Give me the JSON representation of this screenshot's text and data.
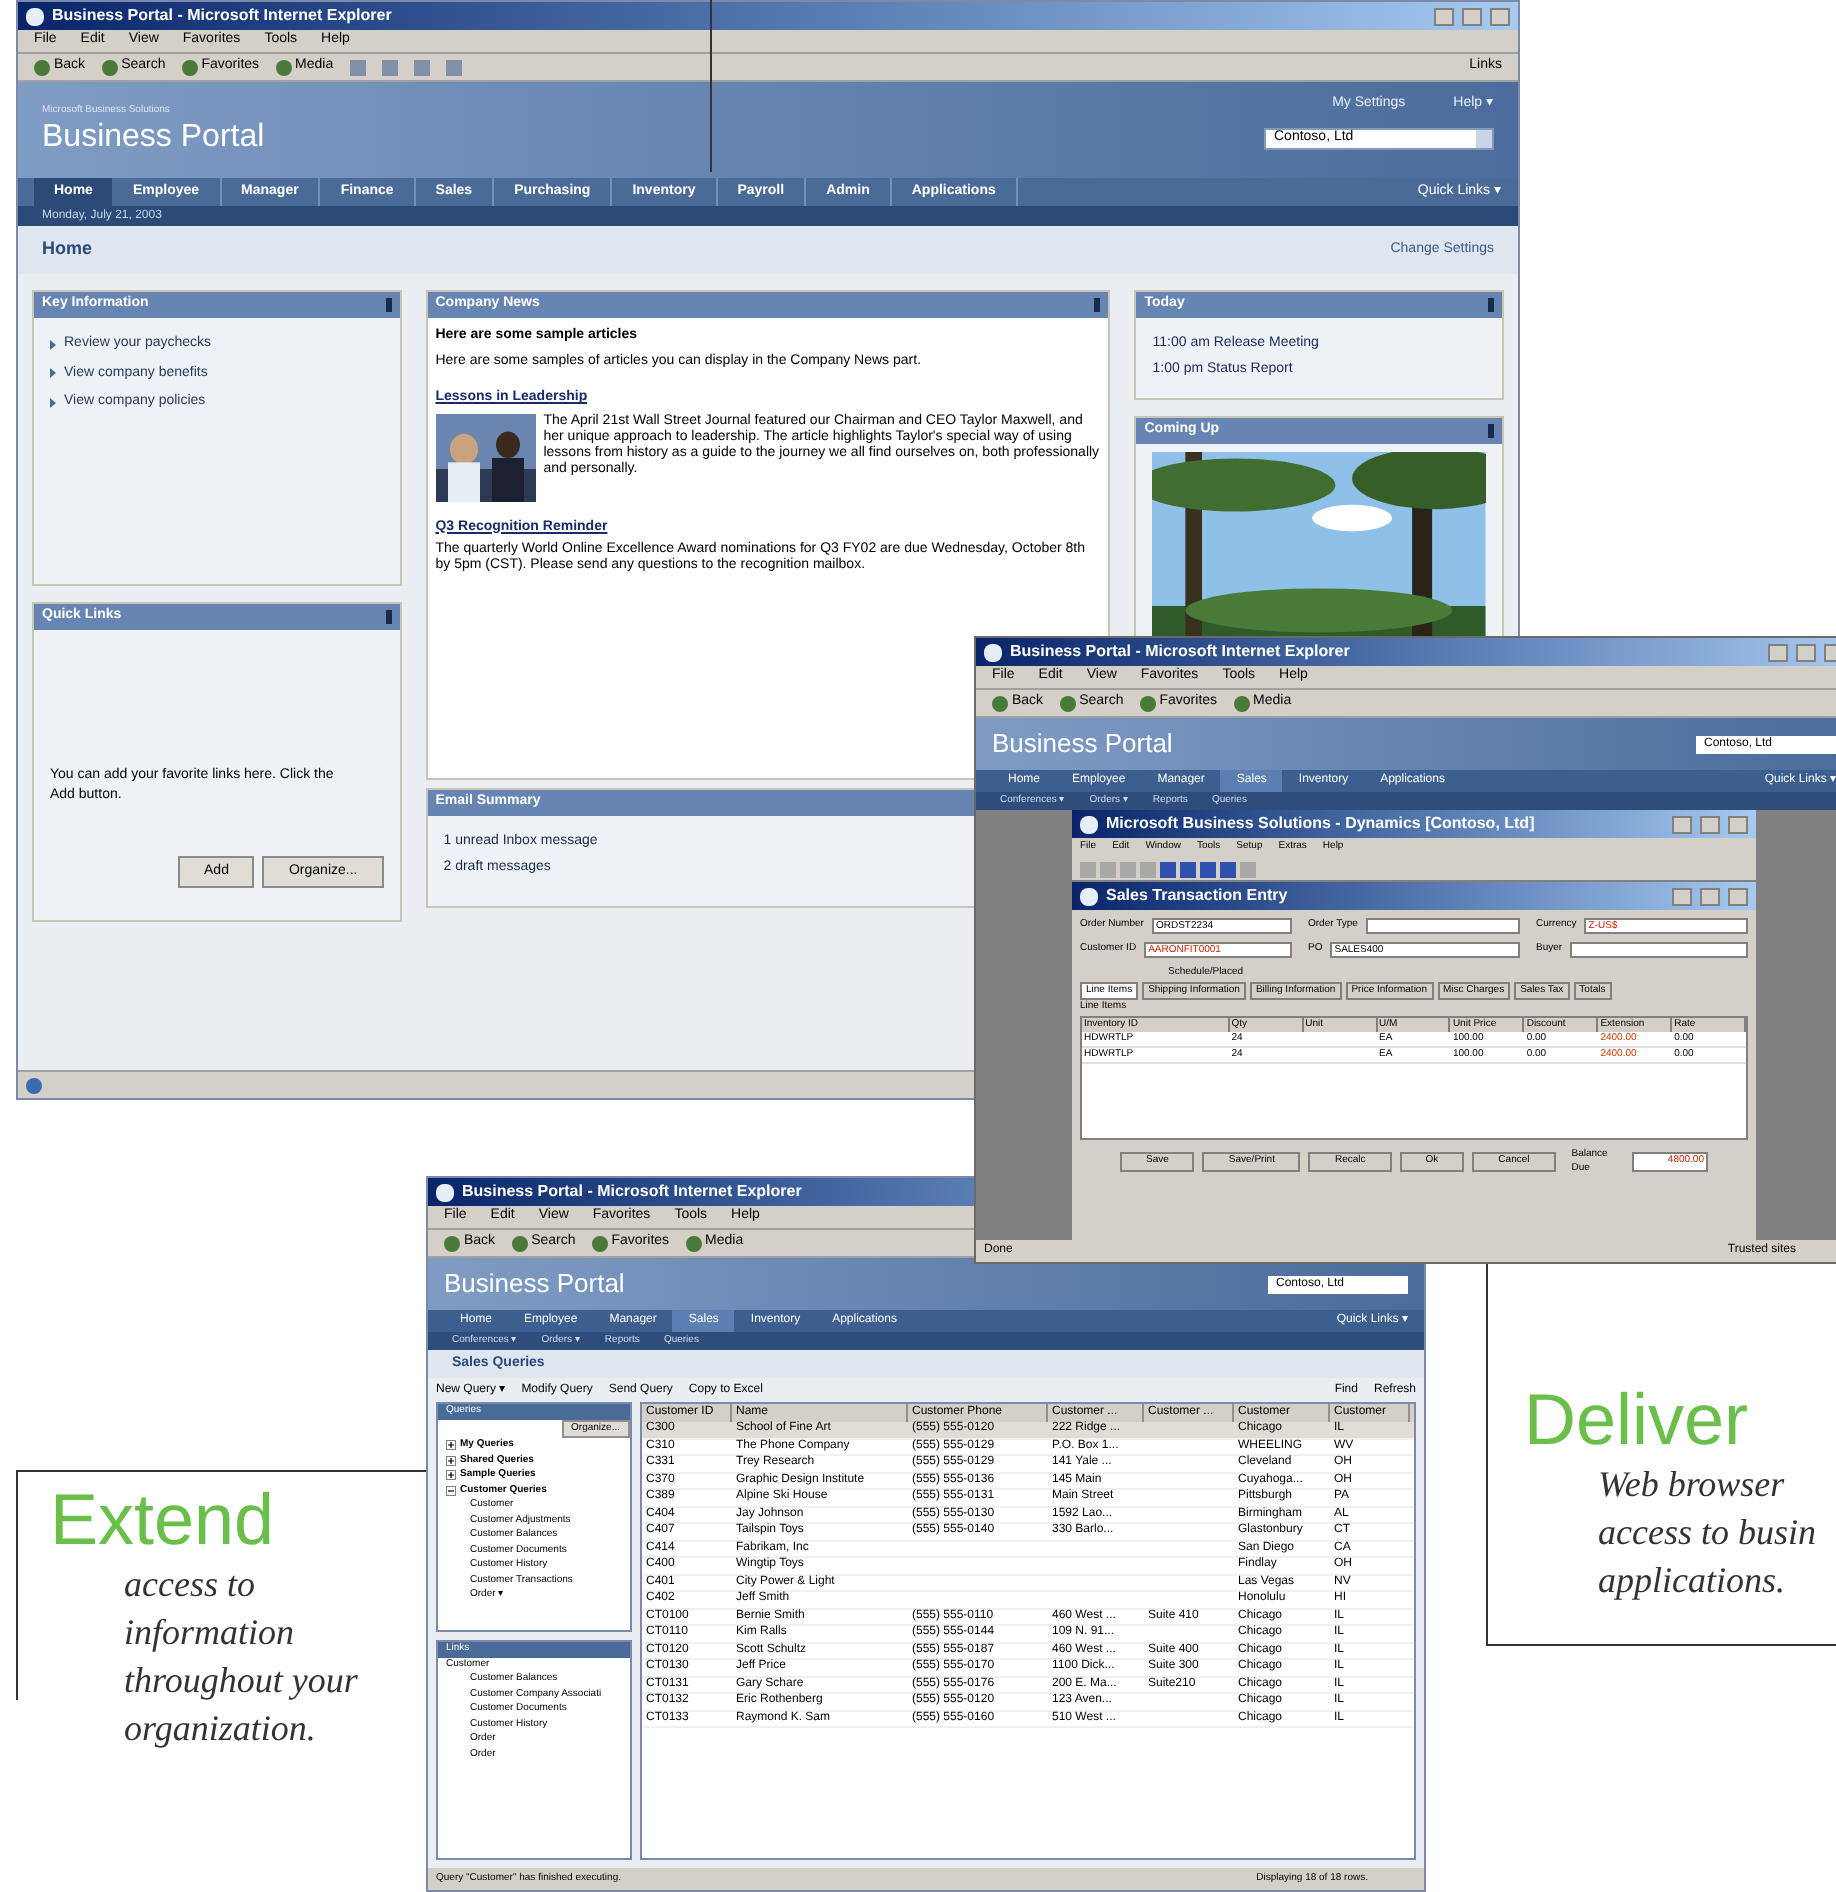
{
  "main_window": {
    "title": "Business Portal - Microsoft Internet Explorer",
    "menu": [
      "File",
      "Edit",
      "View",
      "Favorites",
      "Tools",
      "Help"
    ],
    "toolbar": [
      "Back",
      "Search",
      "Favorites",
      "Media"
    ],
    "links_label": "Links",
    "portal": {
      "brand_small": "Microsoft Business Solutions",
      "brand": "Business Portal",
      "header_links": [
        "My Settings",
        "Help ▾"
      ],
      "company": "Contoso, Ltd",
      "tabs": [
        {
          "label": "Home",
          "selected": true
        },
        {
          "label": "Employee",
          "selected": false
        },
        {
          "label": "Manager",
          "selected": false
        },
        {
          "label": "Finance",
          "selected": false
        },
        {
          "label": "Sales",
          "selected": false
        },
        {
          "label": "Purchasing",
          "selected": false
        },
        {
          "label": "Inventory",
          "selected": false
        },
        {
          "label": "Payroll",
          "selected": false
        },
        {
          "label": "Admin",
          "selected": false
        },
        {
          "label": "Applications",
          "selected": false
        }
      ],
      "quick_links": "Quick Links ▾",
      "date": "Monday, July 21, 2003",
      "page_title": "Home",
      "change_settings": "Change Settings",
      "key_info": {
        "title": "Key Information",
        "links": [
          "Review your paychecks",
          "View company benefits",
          "View company policies"
        ]
      },
      "quick": {
        "title": "Quick Links",
        "text": "You can add your favorite links here. Click the Add button.",
        "buttons": [
          "Add",
          "Organize..."
        ]
      },
      "news": {
        "title": "Company News",
        "heading": "Here are some sample articles",
        "intro": "Here are some samples of articles you can display in the Company News part.",
        "articles": [
          {
            "title": "Lessons in Leadership",
            "picture": true,
            "text": "The April 21st Wall Street Journal featured our Chairman and CEO Taylor Maxwell, and her unique approach to leadership. The article highlights Taylor's special way of using lessons from history as a guide to the journey we all find ourselves on, both professionally and personally."
          },
          {
            "title": "Q3 Recognition Reminder",
            "picture": false,
            "text": "The quarterly World Online Excellence Award nominations for Q3 FY02 are due Wednesday, October 8th by 5pm (CST). Please send any questions to the recognition mailbox."
          }
        ]
      },
      "email": {
        "title": "Email Summary",
        "lines": [
          "1 unread Inbox message",
          "2 draft messages"
        ]
      },
      "today": {
        "title": "Today",
        "events": [
          {
            "time": "11:00 am",
            "text": "Release Meeting"
          },
          {
            "time": "1:00 pm",
            "text": "Status Report"
          }
        ]
      },
      "coming_up": {
        "title": "Coming Up"
      }
    }
  },
  "order_window": {
    "title": "Business Portal - Microsoft Internet Explorer",
    "menu": [
      "File",
      "Edit",
      "View",
      "Favorites",
      "Tools",
      "Help"
    ],
    "toolbar": [
      "Back",
      "Search",
      "Favorites",
      "Media"
    ],
    "portal": {
      "brand": "Business Portal",
      "company": "Contoso, Ltd",
      "tabs": [
        {
          "label": "Home",
          "selected": false
        },
        {
          "label": "Employee",
          "selected": false
        },
        {
          "label": "Manager",
          "selected": false
        },
        {
          "label": "Sales",
          "selected": true
        },
        {
          "label": "Inventory",
          "selected": false
        },
        {
          "label": "Applications",
          "selected": false
        }
      ],
      "quick_links": "Quick Links ▾",
      "subnav": [
        "Conferences ▾",
        "Orders ▾",
        "Reports",
        "Queries"
      ]
    },
    "app": {
      "title": "Microsoft Business Solutions - Dynamics [Contoso, Ltd]",
      "menu": [
        "File",
        "Edit",
        "Window",
        "Tools",
        "Setup",
        "Extras",
        "Help"
      ],
      "form": {
        "title": "Sales Transaction Entry",
        "fields": [
          {
            "label": "Order Number",
            "value": "ORDST2234",
            "alert": false
          },
          {
            "label": "Order Type",
            "alert": false
          },
          {
            "label": "Currency",
            "value": "Z-US$",
            "alert": true
          },
          {
            "label": "Customer ID",
            "value": "AARONFIT0001",
            "alert": true
          },
          {
            "label": "PO",
            "value": "SALES400",
            "alert": false
          },
          {
            "label": "Buyer",
            "alert": false
          }
        ],
        "sub_label": "Schedule/Placed",
        "tabs": [
          {
            "label": "Line Items",
            "selected": true
          },
          {
            "label": "Shipping Information",
            "selected": false
          },
          {
            "label": "Billing Information",
            "selected": false
          },
          {
            "label": "Price Information",
            "selected": false
          },
          {
            "label": "Misc Charges",
            "selected": false
          },
          {
            "label": "Sales Tax",
            "selected": false
          },
          {
            "label": "Totals",
            "selected": false
          }
        ],
        "grid_title": "Line Items",
        "columns": [
          "Inventory ID",
          "Qty",
          "Unit",
          "U/M",
          "Unit Price",
          "Discount",
          "Extension",
          "Rate"
        ],
        "rows": [
          [
            "HDWRTLP",
            "24",
            null,
            "EA",
            "100.00",
            "0.00",
            "2400.00",
            "0.00"
          ],
          [
            "HDWRTLP",
            "24",
            null,
            "EA",
            "100.00",
            "0.00",
            "2400.00",
            "0.00"
          ]
        ],
        "buttons": [
          "Save",
          "Save/Print",
          "Recalc",
          "Ok",
          "Cancel"
        ],
        "total_label": "Balance Due",
        "total": "4800.00"
      }
    },
    "status": "Done",
    "zone": "Trusted sites"
  },
  "query_window": {
    "title": "Business Portal - Microsoft Internet Explorer",
    "menu": [
      "File",
      "Edit",
      "View",
      "Favorites",
      "Tools",
      "Help"
    ],
    "toolbar": [
      "Back",
      "Search",
      "Favorites",
      "Media"
    ],
    "portal": {
      "brand": "Business Portal",
      "company": "Contoso, Ltd",
      "tabs": [
        {
          "label": "Home",
          "selected": false
        },
        {
          "label": "Employee",
          "selected": false
        },
        {
          "label": "Manager",
          "selected": false
        },
        {
          "label": "Sales",
          "selected": true
        },
        {
          "label": "Inventory",
          "selected": false
        },
        {
          "label": "Applications",
          "selected": false
        }
      ],
      "quick_links": "Quick Links ▾",
      "subnav": [
        "Conferences ▾",
        "Orders ▾",
        "Reports",
        "Queries"
      ]
    },
    "page_title": "Sales Queries",
    "actions": [
      "New Query ▾",
      "Modify Query",
      "Send Query",
      "Copy to Excel"
    ],
    "right_actions": [
      "Find",
      "Refresh"
    ],
    "queries": {
      "title": "Queries",
      "organize": "Organize...",
      "tree": [
        {
          "label": "My Queries",
          "expanded": false
        },
        {
          "label": "Shared Queries",
          "expanded": false
        },
        {
          "label": "Sample Queries",
          "expanded": false
        },
        {
          "label": "Customer Queries",
          "expanded": true,
          "children": [
            "Customer",
            "Customer Adjustments",
            "Customer Balances",
            "Customer Documents",
            "Customer History",
            "Customer Transactions",
            "Order ▾"
          ]
        }
      ]
    },
    "links": {
      "title": "Links",
      "root": "Customer",
      "children": [
        "Customer Balances",
        "Customer Company Associati",
        "Customer Documents",
        "Customer History",
        "Order",
        "Order"
      ]
    },
    "table": {
      "columns": [
        "Customer ID",
        "Name",
        "Customer Phone",
        "Customer ...",
        "Customer ...",
        "Customer",
        "Customer"
      ],
      "rows": [
        [
          "C300",
          "School of Fine Art",
          "(555) 555-0120",
          "222 Ridge ...",
          null,
          "Chicago",
          "IL"
        ],
        [
          "C310",
          "The Phone Company",
          "(555) 555-0129",
          "P.O. Box 1...",
          null,
          "WHEELING",
          "WV"
        ],
        [
          "C331",
          "Trey Research",
          "(555) 555-0129",
          "141 Yale ...",
          null,
          "Cleveland",
          "OH"
        ],
        [
          "C370",
          "Graphic Design Institute",
          "(555) 555-0136",
          "145 Main",
          null,
          "Cuyahoga...",
          "OH"
        ],
        [
          "C389",
          "Alpine Ski House",
          "(555) 555-0131",
          "Main Street",
          null,
          "Pittsburgh",
          "PA"
        ],
        [
          "C404",
          "Jay Johnson",
          "(555) 555-0130",
          "1592 Lao...",
          null,
          "Birmingham",
          "AL"
        ],
        [
          "C407",
          "Tailspin Toys",
          "(555) 555-0140",
          "330 Barlo...",
          null,
          "Glastonbury",
          "CT"
        ],
        [
          "C414",
          "Fabrikam, Inc",
          null,
          null,
          null,
          "San Diego",
          "CA"
        ],
        [
          "C400",
          "Wingtip Toys",
          null,
          null,
          null,
          "Findlay",
          "OH"
        ],
        [
          "C401",
          "City Power & Light",
          null,
          null,
          null,
          "Las Vegas",
          "NV"
        ],
        [
          "C402",
          "Jeff Smith",
          null,
          null,
          null,
          "Honolulu",
          "HI"
        ],
        [
          "CT0100",
          "Bernie Smith",
          "(555) 555-0110",
          "460 West ...",
          "Suite 410",
          "Chicago",
          "IL"
        ],
        [
          "CT0110",
          "Kim Ralls",
          "(555) 555-0144",
          "109 N. 91...",
          null,
          "Chicago",
          "IL"
        ],
        [
          "CT0120",
          "Scott Schultz",
          "(555) 555-0187",
          "460 West ...",
          "Suite 400",
          "Chicago",
          "IL"
        ],
        [
          "CT0130",
          "Jeff Price",
          "(555) 555-0170",
          "1100 Dick...",
          "Suite 300",
          "Chicago",
          "IL"
        ],
        [
          "CT0131",
          "Gary Schare",
          "(555) 555-0176",
          "200 E. Ma...",
          "Suite210",
          "Chicago",
          "IL"
        ],
        [
          "CT0132",
          "Eric Rothenberg",
          "(555) 555-0120",
          "123 Aven...",
          null,
          "Chicago",
          "IL"
        ],
        [
          "CT0133",
          "Raymond K. Sam",
          "(555) 555-0160",
          "510 West ...",
          null,
          "Chicago",
          "IL"
        ]
      ]
    },
    "status": "Query \"Customer\" has finished executing.",
    "count": "Displaying 18 of 18 rows."
  },
  "callouts": [
    {
      "heading": "Extend",
      "lines": [
        "access to",
        "information",
        "throughout your",
        "organization."
      ]
    },
    {
      "heading": "Deliver",
      "lines": [
        "Web browser",
        "access to busin",
        "applications."
      ]
    }
  ]
}
